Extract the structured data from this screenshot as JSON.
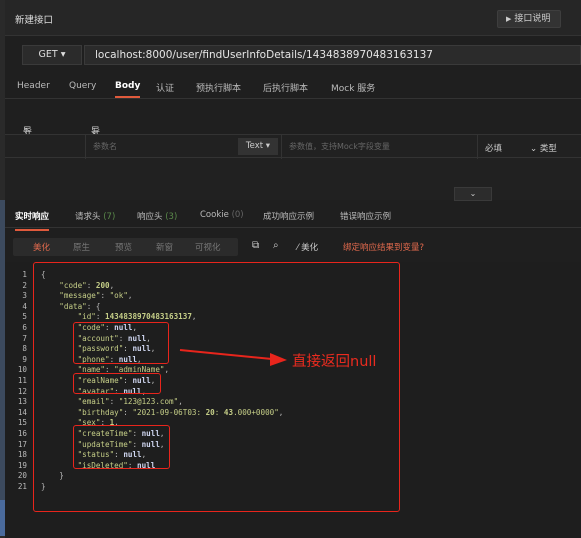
{
  "window": {
    "title": "新建接口",
    "doc_button": "接口说明",
    "doc_button_icon": "triangle-right-icon"
  },
  "request": {
    "method": "GET",
    "url": "localhost:8000/user/findUserInfoDetails/1434838970483163137"
  },
  "request_tabs": [
    "Header",
    "Query",
    "Body",
    "认证",
    "预执行脚本",
    "后执行脚本",
    "Mock 服务"
  ],
  "request_tabs_active": "Body",
  "io": {
    "import_label": "导入参数",
    "export_label": "导出参数"
  },
  "param_row": {
    "name_placeholder": "参数名",
    "type_select": "Text",
    "value_placeholder": "参数值，支持Mock字段变量",
    "required_label": "必填",
    "type_label": "类型"
  },
  "response_tabs": [
    {
      "label": "实时响应",
      "count": ""
    },
    {
      "label": "请求头",
      "count": "(7)"
    },
    {
      "label": "响应头",
      "count": "(3)"
    },
    {
      "label": "Cookie",
      "count": "(0)"
    },
    {
      "label": "成功响应示例",
      "count": ""
    },
    {
      "label": "错误响应示例",
      "count": ""
    }
  ],
  "response_tabs_active": "实时响应",
  "view_modes": [
    "美化",
    "原生",
    "预览",
    "新窗",
    "可视化"
  ],
  "view_mode_active": "美化",
  "toolbar": {
    "beautify_label": "美化",
    "bind_var_label": "绑定响应结果到变量?"
  },
  "code_lines": [
    "{",
    "    \"code\": 200,",
    "    \"message\": \"ok\",",
    "    \"data\": {",
    "        \"id\": 1434838970483163137,",
    "        \"code\": null,",
    "        \"account\": null,",
    "        \"password\": null,",
    "        \"phone\": null,",
    "        \"name\": \"adminName\",",
    "        \"realName\": null,",
    "        \"avatar\": null,",
    "        \"email\": \"123@123.com\",",
    "        \"birthday\": \"2021-09-06T03:20:43.000+0000\",",
    "        \"sex\": 1,",
    "        \"createTime\": null,",
    "        \"updateTime\": null,",
    "        \"status\": null,",
    "        \"isDeleted\": null",
    "    }",
    "}"
  ],
  "annotation": {
    "text": "直接返回null",
    "color": "#ea2b1f"
  },
  "colors": {
    "accent": "#e05a3c",
    "annotation_red": "#e8251c",
    "background": "#1f1f1f"
  }
}
